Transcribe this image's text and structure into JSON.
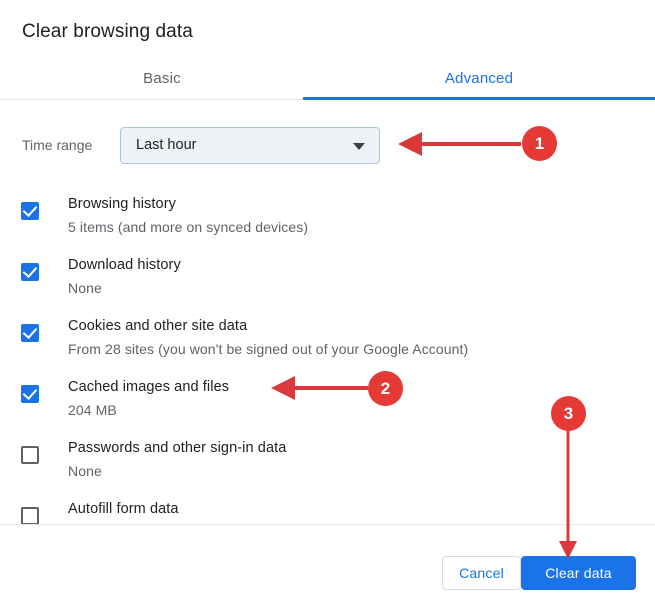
{
  "dialog": {
    "title": "Clear browsing data"
  },
  "tabs": [
    {
      "label": "Basic",
      "active": false
    },
    {
      "label": "Advanced",
      "active": true
    }
  ],
  "time_range": {
    "label": "Time range",
    "selected": "Last hour",
    "arrow_icon": "chevron-down-icon"
  },
  "options": [
    {
      "title": "Browsing history",
      "subtitle": "5 items (and more on synced devices)",
      "checked": true
    },
    {
      "title": "Download history",
      "subtitle": "None",
      "checked": true
    },
    {
      "title": "Cookies and other site data",
      "subtitle": "From 28 sites (you won't be signed out of your Google Account)",
      "checked": true
    },
    {
      "title": "Cached images and files",
      "subtitle": "204 MB",
      "checked": true
    },
    {
      "title": "Passwords and other sign-in data",
      "subtitle": "None",
      "checked": false
    },
    {
      "title": "Autofill form data",
      "subtitle": "",
      "checked": false
    }
  ],
  "footer": {
    "cancel_label": "Cancel",
    "clear_label": "Clear data"
  },
  "annotations": [
    {
      "number": "1",
      "target": "time-range-dropdown",
      "direction": "left"
    },
    {
      "number": "2",
      "target": "cached-images-option",
      "direction": "left"
    },
    {
      "number": "3",
      "target": "clear-data-button",
      "direction": "down"
    }
  ],
  "colors": {
    "accent": "#1a73e8",
    "annotation": "#e53935",
    "text_primary": "#202124",
    "text_secondary": "#5f6368",
    "dropdown_fill": "#eef1f5",
    "dropdown_border": "#a8c7e8"
  }
}
